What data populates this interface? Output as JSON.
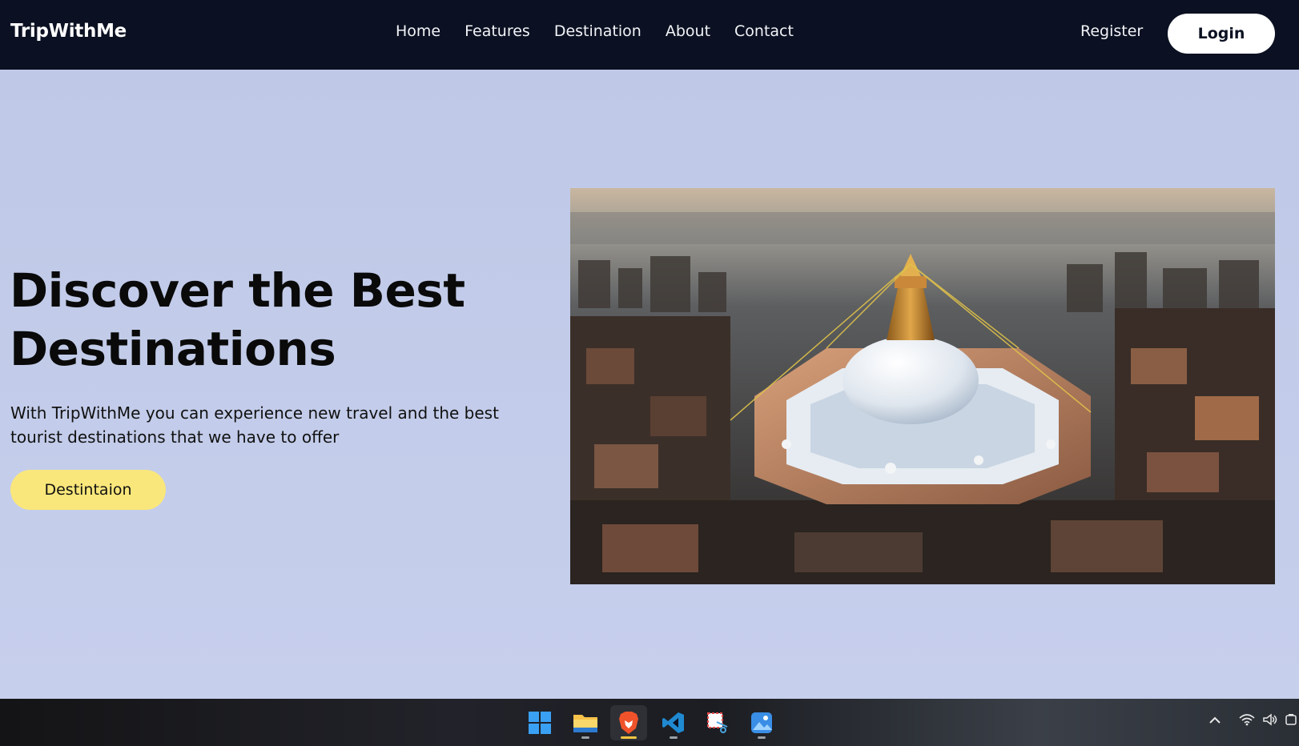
{
  "navbar": {
    "brand": "TripWithMe",
    "links": [
      "Home",
      "Features",
      "Destination",
      "About",
      "Contact"
    ],
    "register": "Register",
    "login": "Login"
  },
  "hero": {
    "title_line1": "Discover the Best",
    "title_line2": "Destinations",
    "subtitle": "With TripWithMe you can experience new travel and the best tourist destinations that we have to offer",
    "cta": "Destintaion",
    "image_subject": "aerial view of a stupa in a city"
  },
  "taskbar": {
    "apps": [
      "windows-start-icon",
      "file-explorer-icon",
      "brave-browser-icon",
      "vscode-icon",
      "snipping-tool-icon",
      "photos-icon"
    ],
    "tray_icons": [
      "chevron-up-icon",
      "wifi-icon",
      "volume-icon",
      "battery-icon"
    ]
  },
  "colors": {
    "navbar_bg": "#0b1122",
    "hero_bg": "#c3cce8",
    "cta_bg": "#fae77b",
    "login_bg": "#ffffff"
  }
}
